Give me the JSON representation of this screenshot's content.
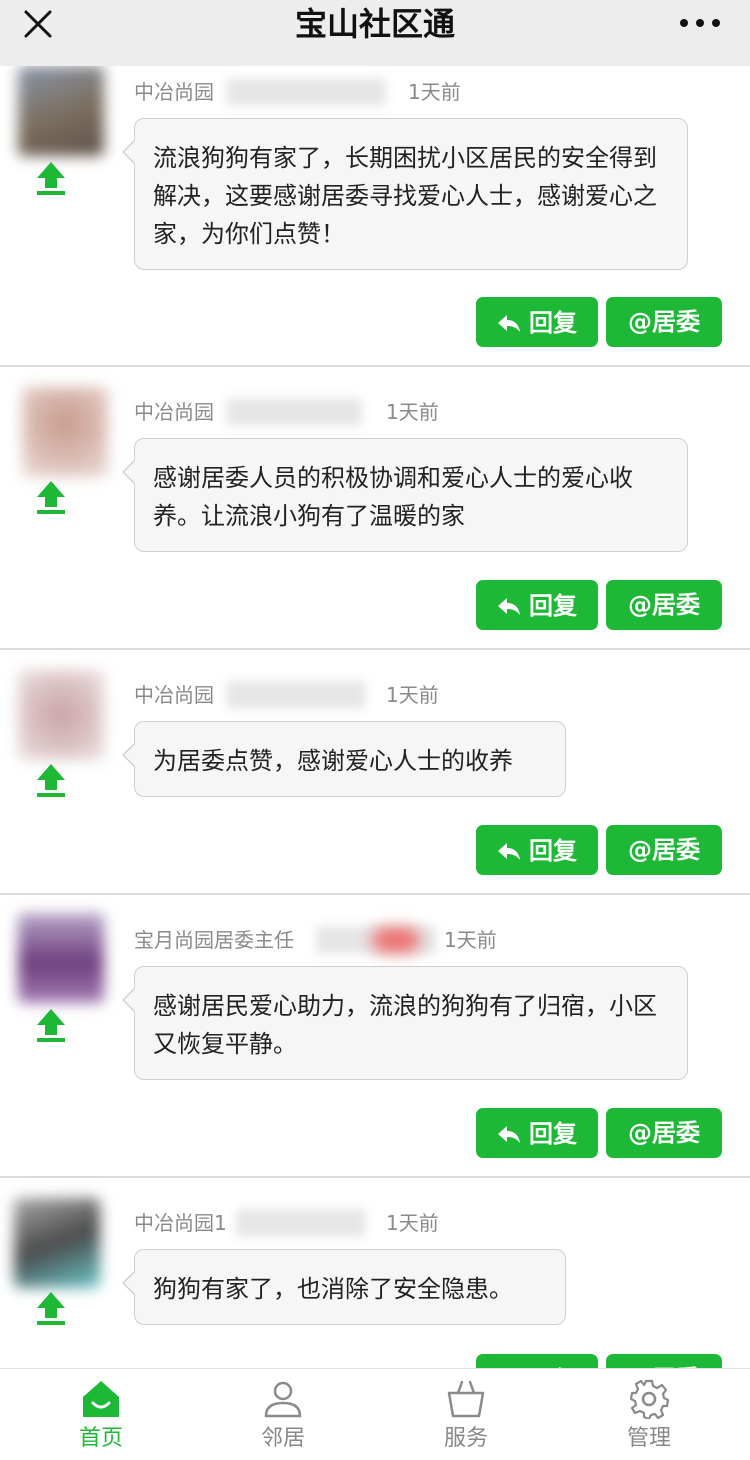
{
  "header": {
    "title": "宝山社区通"
  },
  "colors": {
    "accent": "#1db836",
    "bubble_bg": "#f6f6f6",
    "meta_text": "#8a8a8a"
  },
  "icons": {
    "close": "close-icon",
    "more": "more-icon",
    "upvote": "upvote-arrow-icon",
    "reply": "reply-arrow-icon"
  },
  "posts": [
    {
      "community": "中冶尚园",
      "time": "1天前",
      "text": "流浪狗狗有家了，长期困扰小区居民的安全得到解决，这要感谢居委寻找爱心人士，感谢爱心之家，为你们点赞！",
      "reply_label": "回复",
      "mention_label": "@居委"
    },
    {
      "community": "中冶尚园",
      "time": "1天前",
      "text": "感谢居委人员的积极协调和爱心人士的爱心收养。让流浪小狗有了温暖的家",
      "reply_label": "回复",
      "mention_label": "@居委"
    },
    {
      "community": "中冶尚园",
      "time": "1天前",
      "text": "为居委点赞，感谢爱心人士的收养",
      "reply_label": "回复",
      "mention_label": "@居委"
    },
    {
      "community": "宝月尚园居委主任",
      "time": "1天前",
      "text": "感谢居民爱心助力，流浪的狗狗有了归宿，小区又恢复平静。",
      "reply_label": "回复",
      "mention_label": "@居委"
    },
    {
      "community": "中冶尚园1",
      "time": "1天前",
      "text": "狗狗有家了，也消除了安全隐患。",
      "reply_label": "回复",
      "mention_label": "@居委"
    }
  ],
  "tabbar": {
    "items": [
      {
        "label": "首页",
        "active": true
      },
      {
        "label": "邻居",
        "active": false
      },
      {
        "label": "服务",
        "active": false
      },
      {
        "label": "管理",
        "active": false
      }
    ]
  }
}
